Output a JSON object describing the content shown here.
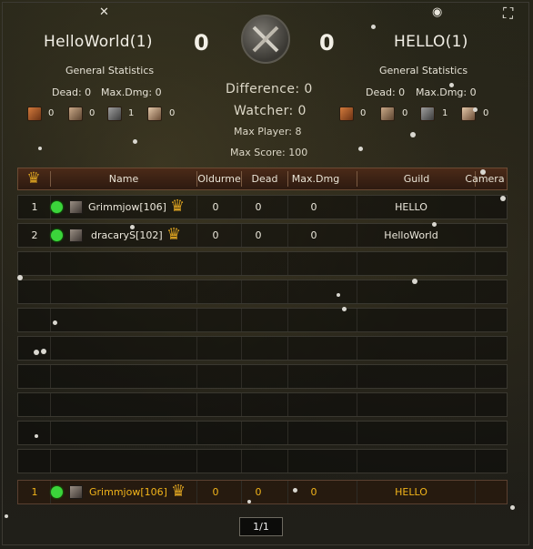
{
  "team_left": {
    "name": "HelloWorld(1)",
    "score": "0",
    "stats_title": "General Statistics",
    "dead_label": "Dead: 0",
    "maxdmg_label": "Max.Dmg: 0",
    "class_counts": [
      "0",
      "0",
      "1",
      "0"
    ],
    "icon": "axes-emblem-icon"
  },
  "team_right": {
    "name": "HELLO(1)",
    "score": "0",
    "stats_title": "General Statistics",
    "dead_label": "Dead: 0",
    "maxdmg_label": "Max.Dmg: 0",
    "class_counts": [
      "0",
      "0",
      "1",
      "0"
    ],
    "icon": "eye-icon"
  },
  "center": {
    "difference": "Difference: 0",
    "watcher": "Watcher: 0",
    "max_player": "Max Player: 8",
    "max_score": "Max Score: 100",
    "emblem": "crossed-swords-emblem-icon"
  },
  "table": {
    "headers": {
      "name": "Name",
      "oldurme": "Oldurme",
      "dead": "Dead",
      "maxdmg": "Max.Dmg",
      "guild": "Guild",
      "camera": "Camera"
    },
    "rows": [
      {
        "rank": "1",
        "name": "Grimmjow[106]",
        "oldurme": "0",
        "dead": "0",
        "maxdmg": "0",
        "guild": "HELLO"
      },
      {
        "rank": "2",
        "name": "dracaryS[102]",
        "oldurme": "0",
        "dead": "0",
        "maxdmg": "0",
        "guild": "HelloWorld"
      }
    ],
    "self_row": {
      "rank": "1",
      "name": "Grimmjow[106]",
      "oldurme": "0",
      "dead": "0",
      "maxdmg": "0",
      "guild": "HELLO"
    }
  },
  "pagination": "1/1",
  "colors": {
    "self_row_text": "#f2b41a",
    "online": "#3bd43b",
    "crown": "#d9a020"
  }
}
